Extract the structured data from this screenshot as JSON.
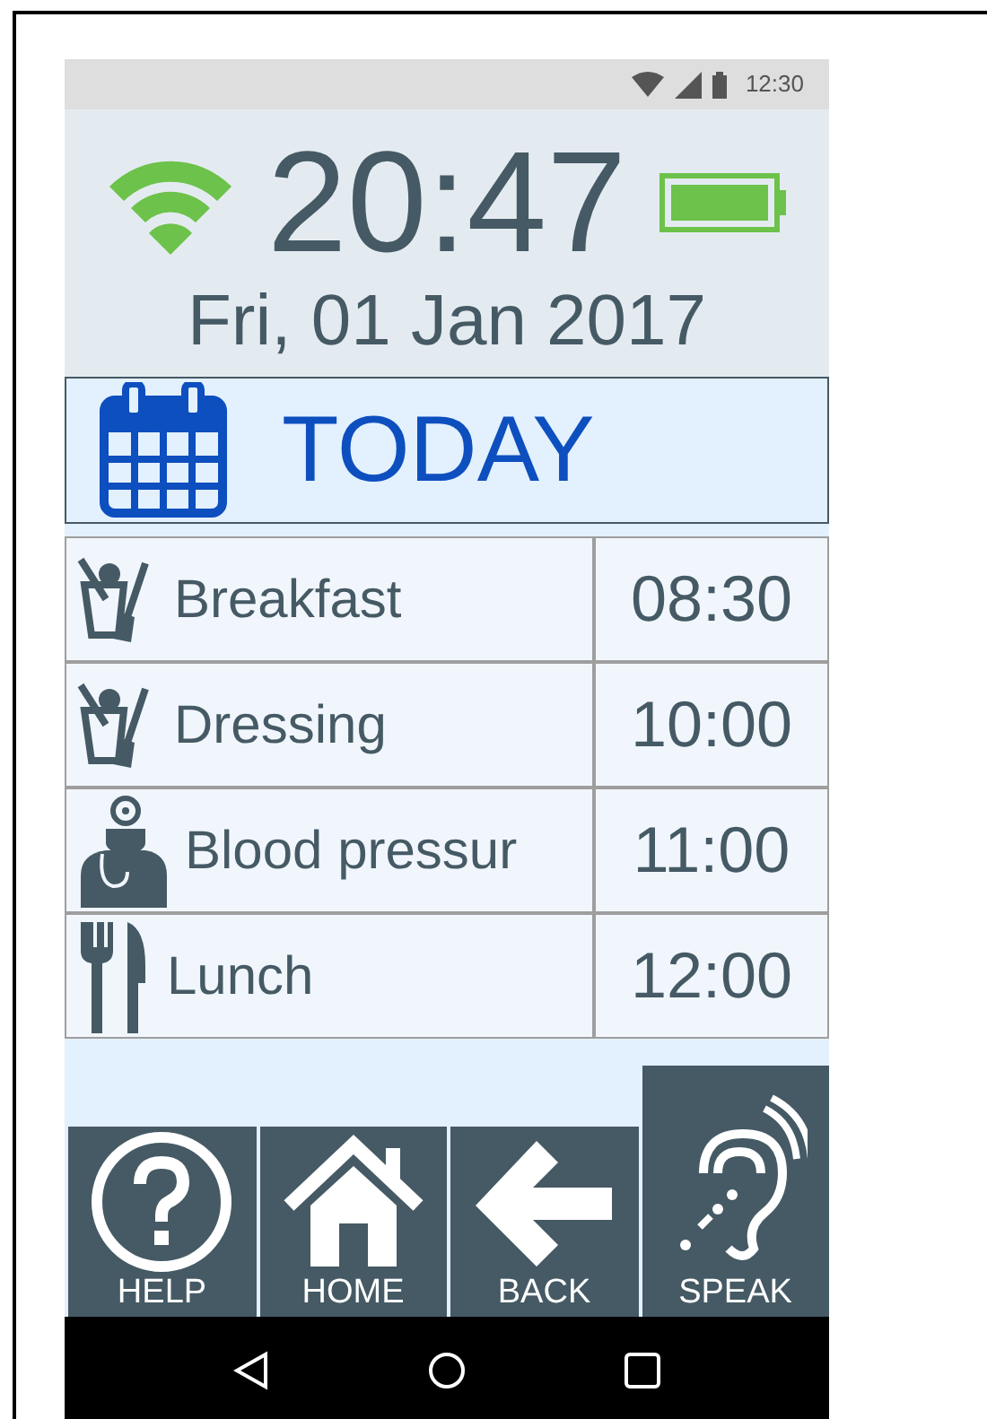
{
  "status_bar": {
    "time": "12:30"
  },
  "header": {
    "clock": "20:47",
    "date": "Fri, 01 Jan 2017"
  },
  "title": "TODAY",
  "schedule": [
    {
      "kind": "chores",
      "activity": "Breakfast",
      "time": "08:30"
    },
    {
      "kind": "chores",
      "activity": "Dressing",
      "time": "10:00"
    },
    {
      "kind": "doctor",
      "activity": "Blood pressur",
      "time": "11:00"
    },
    {
      "kind": "meal",
      "activity": "Lunch",
      "time": "12:00"
    }
  ],
  "buttons": [
    {
      "kind": "help",
      "label": "HELP",
      "selected": false
    },
    {
      "kind": "home",
      "label": "HOME",
      "selected": false
    },
    {
      "kind": "back",
      "label": "BACK",
      "selected": false
    },
    {
      "kind": "speak",
      "label": "SPEAK",
      "selected": true
    }
  ]
}
